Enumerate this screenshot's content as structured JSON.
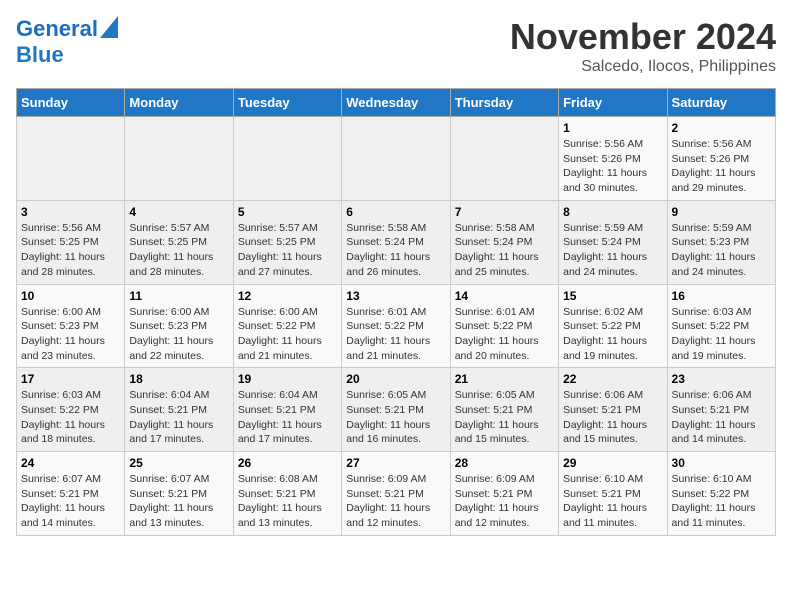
{
  "header": {
    "logo_line1": "General",
    "logo_line2": "Blue",
    "month_year": "November 2024",
    "location": "Salcedo, Ilocos, Philippines"
  },
  "weekdays": [
    "Sunday",
    "Monday",
    "Tuesday",
    "Wednesday",
    "Thursday",
    "Friday",
    "Saturday"
  ],
  "weeks": [
    [
      {
        "day": "",
        "info": ""
      },
      {
        "day": "",
        "info": ""
      },
      {
        "day": "",
        "info": ""
      },
      {
        "day": "",
        "info": ""
      },
      {
        "day": "",
        "info": ""
      },
      {
        "day": "1",
        "info": "Sunrise: 5:56 AM\nSunset: 5:26 PM\nDaylight: 11 hours and 30 minutes."
      },
      {
        "day": "2",
        "info": "Sunrise: 5:56 AM\nSunset: 5:26 PM\nDaylight: 11 hours and 29 minutes."
      }
    ],
    [
      {
        "day": "3",
        "info": "Sunrise: 5:56 AM\nSunset: 5:25 PM\nDaylight: 11 hours and 28 minutes."
      },
      {
        "day": "4",
        "info": "Sunrise: 5:57 AM\nSunset: 5:25 PM\nDaylight: 11 hours and 28 minutes."
      },
      {
        "day": "5",
        "info": "Sunrise: 5:57 AM\nSunset: 5:25 PM\nDaylight: 11 hours and 27 minutes."
      },
      {
        "day": "6",
        "info": "Sunrise: 5:58 AM\nSunset: 5:24 PM\nDaylight: 11 hours and 26 minutes."
      },
      {
        "day": "7",
        "info": "Sunrise: 5:58 AM\nSunset: 5:24 PM\nDaylight: 11 hours and 25 minutes."
      },
      {
        "day": "8",
        "info": "Sunrise: 5:59 AM\nSunset: 5:24 PM\nDaylight: 11 hours and 24 minutes."
      },
      {
        "day": "9",
        "info": "Sunrise: 5:59 AM\nSunset: 5:23 PM\nDaylight: 11 hours and 24 minutes."
      }
    ],
    [
      {
        "day": "10",
        "info": "Sunrise: 6:00 AM\nSunset: 5:23 PM\nDaylight: 11 hours and 23 minutes."
      },
      {
        "day": "11",
        "info": "Sunrise: 6:00 AM\nSunset: 5:23 PM\nDaylight: 11 hours and 22 minutes."
      },
      {
        "day": "12",
        "info": "Sunrise: 6:00 AM\nSunset: 5:22 PM\nDaylight: 11 hours and 21 minutes."
      },
      {
        "day": "13",
        "info": "Sunrise: 6:01 AM\nSunset: 5:22 PM\nDaylight: 11 hours and 21 minutes."
      },
      {
        "day": "14",
        "info": "Sunrise: 6:01 AM\nSunset: 5:22 PM\nDaylight: 11 hours and 20 minutes."
      },
      {
        "day": "15",
        "info": "Sunrise: 6:02 AM\nSunset: 5:22 PM\nDaylight: 11 hours and 19 minutes."
      },
      {
        "day": "16",
        "info": "Sunrise: 6:03 AM\nSunset: 5:22 PM\nDaylight: 11 hours and 19 minutes."
      }
    ],
    [
      {
        "day": "17",
        "info": "Sunrise: 6:03 AM\nSunset: 5:22 PM\nDaylight: 11 hours and 18 minutes."
      },
      {
        "day": "18",
        "info": "Sunrise: 6:04 AM\nSunset: 5:21 PM\nDaylight: 11 hours and 17 minutes."
      },
      {
        "day": "19",
        "info": "Sunrise: 6:04 AM\nSunset: 5:21 PM\nDaylight: 11 hours and 17 minutes."
      },
      {
        "day": "20",
        "info": "Sunrise: 6:05 AM\nSunset: 5:21 PM\nDaylight: 11 hours and 16 minutes."
      },
      {
        "day": "21",
        "info": "Sunrise: 6:05 AM\nSunset: 5:21 PM\nDaylight: 11 hours and 15 minutes."
      },
      {
        "day": "22",
        "info": "Sunrise: 6:06 AM\nSunset: 5:21 PM\nDaylight: 11 hours and 15 minutes."
      },
      {
        "day": "23",
        "info": "Sunrise: 6:06 AM\nSunset: 5:21 PM\nDaylight: 11 hours and 14 minutes."
      }
    ],
    [
      {
        "day": "24",
        "info": "Sunrise: 6:07 AM\nSunset: 5:21 PM\nDaylight: 11 hours and 14 minutes."
      },
      {
        "day": "25",
        "info": "Sunrise: 6:07 AM\nSunset: 5:21 PM\nDaylight: 11 hours and 13 minutes."
      },
      {
        "day": "26",
        "info": "Sunrise: 6:08 AM\nSunset: 5:21 PM\nDaylight: 11 hours and 13 minutes."
      },
      {
        "day": "27",
        "info": "Sunrise: 6:09 AM\nSunset: 5:21 PM\nDaylight: 11 hours and 12 minutes."
      },
      {
        "day": "28",
        "info": "Sunrise: 6:09 AM\nSunset: 5:21 PM\nDaylight: 11 hours and 12 minutes."
      },
      {
        "day": "29",
        "info": "Sunrise: 6:10 AM\nSunset: 5:21 PM\nDaylight: 11 hours and 11 minutes."
      },
      {
        "day": "30",
        "info": "Sunrise: 6:10 AM\nSunset: 5:22 PM\nDaylight: 11 hours and 11 minutes."
      }
    ]
  ]
}
